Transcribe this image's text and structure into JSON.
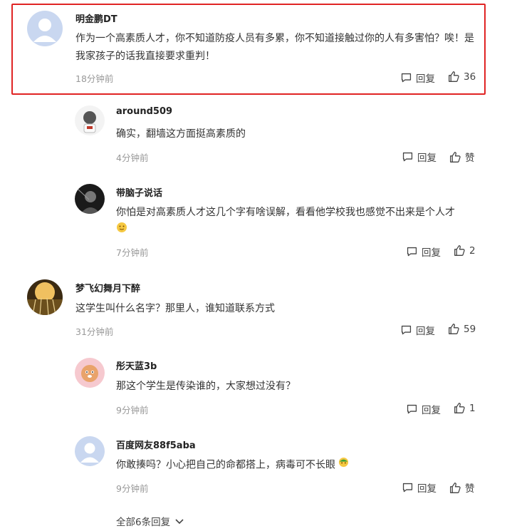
{
  "comments": [
    {
      "user": "明金鹏DT",
      "text": "作为一个高素质人才，你不知道防疫人员有多累，你不知道接触过你的人有多害怕？唉！是我家孩子的话我直接要求重判！",
      "time": "18分钟前",
      "reply": "回复",
      "likes": "36"
    },
    {
      "user": "around509",
      "text": "确实，翻墙这方面挺高素质的",
      "time": "4分钟前",
      "reply": "回复",
      "likes": "赞"
    },
    {
      "user": "带脑子说话",
      "text": "你怕是对高素质人才这几个字有啥误解，看看他学校我也感觉不出来是个人才",
      "time": "7分钟前",
      "reply": "回复",
      "likes": "2"
    },
    {
      "user": "梦飞幻舞月下醉",
      "text": "这学生叫什么名字？那里人，谁知道联系方式",
      "time": "31分钟前",
      "reply": "回复",
      "likes": "59"
    },
    {
      "user": "彤天蓝3b",
      "text": "那这个学生是传染谁的，大家想过没有？",
      "time": "9分钟前",
      "reply": "回复",
      "likes": "1"
    },
    {
      "user": "百度网友88f5aba",
      "text": "你敢揍吗？小心把自己的命都搭上，病毒可不长眼",
      "time": "9分钟前",
      "reply": "回复",
      "likes": "赞"
    }
  ],
  "more_replies": "全部6条回复",
  "colors": {
    "highlight_border": "#e02424",
    "muted": "#999999"
  }
}
